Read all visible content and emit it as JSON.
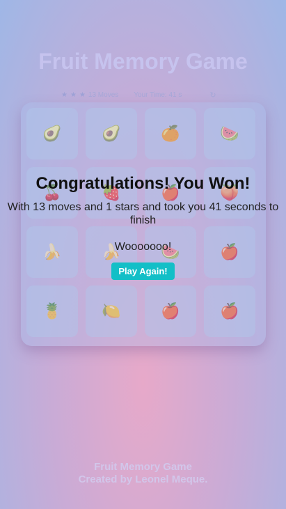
{
  "header": {
    "title": "Fruit Memory Game",
    "stars_glyph": "★",
    "moves_text": "13 Moves",
    "timer_text": "Your Time: 41 s",
    "restart_glyph": "↻"
  },
  "cards": [
    {
      "icon": "avocado-icon",
      "glyph": "🥑"
    },
    {
      "icon": "avocado-icon",
      "glyph": "🥑"
    },
    {
      "icon": "orange-icon",
      "glyph": "🍊"
    },
    {
      "icon": "melon-slice-icon",
      "glyph": "🍉"
    },
    {
      "icon": "cherry-icon",
      "glyph": "🍒"
    },
    {
      "icon": "strawberry-icon",
      "glyph": "🍓"
    },
    {
      "icon": "apple-icon",
      "glyph": "🍎"
    },
    {
      "icon": "peach-icon",
      "glyph": "🍑"
    },
    {
      "icon": "banana-icon",
      "glyph": "🍌"
    },
    {
      "icon": "banana-icon",
      "glyph": "🍌"
    },
    {
      "icon": "watermelon-icon",
      "glyph": "🍉"
    },
    {
      "icon": "apple-half-icon",
      "glyph": "🍎"
    },
    {
      "icon": "pineapple-icon",
      "glyph": "🍍"
    },
    {
      "icon": "lemon-icon",
      "glyph": "🍋"
    },
    {
      "icon": "pomegranate-icon",
      "glyph": "🍎"
    },
    {
      "icon": "apple-half-icon",
      "glyph": "🍎"
    }
  ],
  "modal": {
    "heading": "Congratulations! You Won!",
    "stats": "With 13 moves and 1 stars and took you 41 seconds to finish",
    "message": "Wooooooo!",
    "play_again_label": "Play Again!"
  },
  "footer": {
    "line1": "Fruit Memory Game",
    "line2": "Created by Leonel Meque."
  }
}
